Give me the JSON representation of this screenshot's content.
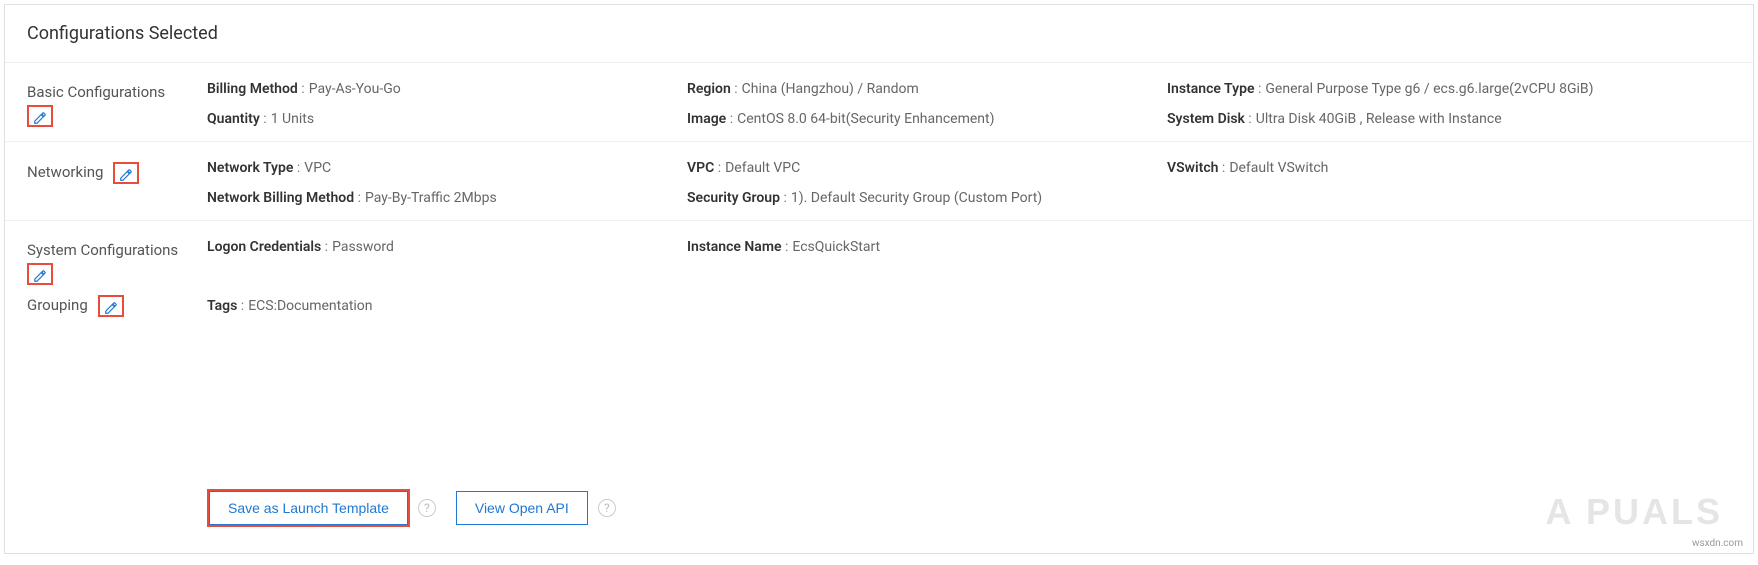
{
  "panel": {
    "title": "Configurations Selected"
  },
  "sections": {
    "basic": {
      "label": "Basic Configurations",
      "billing_method_label": "Billing Method",
      "billing_method_value": "Pay-As-You-Go",
      "region_label": "Region",
      "region_value": "China (Hangzhou) / Random",
      "instance_type_label": "Instance Type",
      "instance_type_value": "General Purpose Type g6 / ecs.g6.large(2vCPU 8GiB)",
      "quantity_label": "Quantity",
      "quantity_value": "1 Units",
      "image_label": "Image",
      "image_value": "CentOS 8.0 64-bit(Security Enhancement)",
      "system_disk_label": "System Disk",
      "system_disk_value": "Ultra Disk 40GiB , Release with Instance"
    },
    "networking": {
      "label": "Networking",
      "network_type_label": "Network Type",
      "network_type_value": "VPC",
      "vpc_label": "VPC",
      "vpc_value": "Default VPC",
      "vswitch_label": "VSwitch",
      "vswitch_value": "Default VSwitch",
      "net_billing_label": "Network Billing Method",
      "net_billing_value": "Pay-By-Traffic 2Mbps",
      "secgroup_label": "Security Group",
      "secgroup_value": "1). Default Security Group (Custom Port)"
    },
    "system": {
      "label": "System Configurations",
      "logon_label": "Logon Credentials",
      "logon_value": "Password",
      "instance_name_label": "Instance Name",
      "instance_name_value": "EcsQuickStart"
    },
    "grouping": {
      "label": "Grouping",
      "tags_label": "Tags",
      "tags_value": "ECS:Documentation"
    }
  },
  "buttons": {
    "save_template": "Save as Launch Template",
    "view_api": "View Open API"
  },
  "help_glyph": "?",
  "watermark": "A  PUALS",
  "watermark_src": "wsxdn.com"
}
